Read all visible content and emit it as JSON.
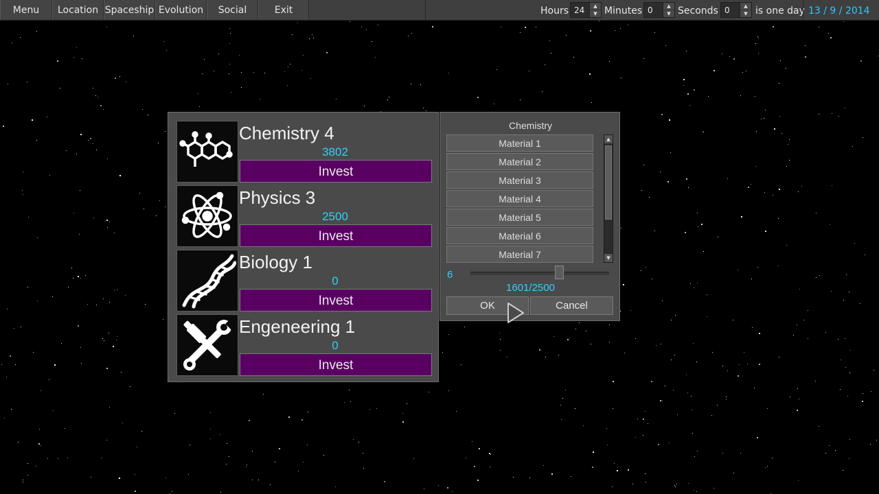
{
  "menu": {
    "items": [
      "Menu",
      "Location",
      "Spaceship",
      "Evolution",
      "Social",
      "Exit"
    ]
  },
  "time_settings": {
    "hours_label": "Hours",
    "hours_value": "24",
    "minutes_label": "Minutes",
    "minutes_value": "0",
    "seconds_label": "Seconds",
    "seconds_value": "0",
    "suffix": "is one day",
    "date": "13 / 9 / 2014"
  },
  "research": {
    "skills": [
      {
        "name": "Chemistry 4",
        "points": "3802",
        "invest_label": "Invest",
        "icon": "molecule-icon"
      },
      {
        "name": "Physics 3",
        "points": "2500",
        "invest_label": "Invest",
        "icon": "atom-icon"
      },
      {
        "name": "Biology 1",
        "points": "0",
        "invest_label": "Invest",
        "icon": "dna-icon"
      },
      {
        "name": "Engeneering 1",
        "points": "0",
        "invest_label": "Invest",
        "icon": "tools-icon"
      }
    ]
  },
  "materials_dialog": {
    "title": "Chemistry",
    "items": [
      "Material 1",
      "Material 2",
      "Material 3",
      "Material 4",
      "Material 5",
      "Material 6",
      "Material 7"
    ],
    "slider_value": "6",
    "slider_fraction": 0.64,
    "readout": "1601/2500",
    "ok_label": "OK",
    "cancel_label": "Cancel"
  },
  "colors": {
    "background": "#000000",
    "panel": "#4a4a4a",
    "invest_button": "#5a0063",
    "accent_cyan": "#2fd1ff"
  }
}
